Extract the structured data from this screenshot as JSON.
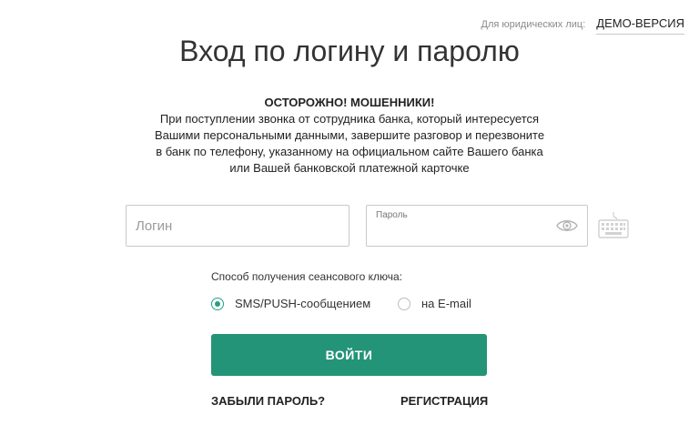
{
  "header": {
    "legal_entities": "Для юридических лиц:",
    "demo_link": "ДЕМО-ВЕРСИЯ"
  },
  "title": "Вход по логину и паролю",
  "warning": {
    "heading": "ОСТОРОЖНО! МОШЕННИКИ!",
    "lines": [
      "При поступлении звонка от сотрудника банка, который интересуется",
      "Вашими персональными данными, завершите разговор и перезвоните",
      "в банк по телефону, указанному на официальном сайте Вашего банка",
      "или Вашей банковской платежной карточке"
    ]
  },
  "login": {
    "placeholder": "Логин",
    "value": ""
  },
  "password": {
    "label": "Пароль",
    "value": ""
  },
  "icons": {
    "show_password": "eye-icon",
    "virtual_keyboard": "keyboard-icon"
  },
  "session_key": {
    "label": "Способ получения сеансового ключа:",
    "options": [
      {
        "label": "SMS/PUSH-сообщением",
        "selected": true
      },
      {
        "label": "на E-mail",
        "selected": false
      }
    ]
  },
  "submit_label": "ВОЙТИ",
  "links": {
    "forgot": "ЗАБЫЛИ ПАРОЛЬ?",
    "register": "РЕГИСТРАЦИЯ"
  },
  "colors": {
    "accent": "#249478",
    "radio_accent": "#279e87"
  }
}
